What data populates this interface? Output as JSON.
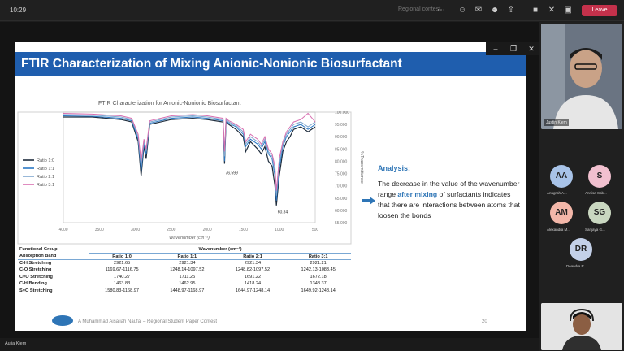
{
  "app": {
    "time": "10:29",
    "meeting_title": "Regional contest",
    "leave_label": "Leave"
  },
  "slide": {
    "title": "FTIR Characterization of Mixing Anionic-Nonionic Biosurfactant",
    "analysis_heading": "Analysis:",
    "analysis_before": "The decrease in the value of the wavenumber range ",
    "analysis_highlight": "after mixing",
    "analysis_after": " of surfactants indicates that there are interactions between atoms that loosen the bonds",
    "footer": "A Muhammad Aisaliah Naufal – Regional Student Paper Contest",
    "page_number": "20"
  },
  "chart_data": {
    "type": "line",
    "title": "FTIR Characterization for Anionic-Nonionic Biosurfactant",
    "xlabel": "Wavenumber (cm⁻¹)",
    "ylabel": "%Transmittance",
    "xlim": [
      4000,
      500
    ],
    "ylim": [
      55,
      100
    ],
    "x_ticks": [
      "4000",
      "3500",
      "3000",
      "2500",
      "2000",
      "1500",
      "1000",
      "500"
    ],
    "y_ticks": [
      "100.000",
      "95.000",
      "90.000",
      "85.000",
      "80.000",
      "75.000",
      "70.000",
      "65.000",
      "60.000",
      "55.000"
    ],
    "x_tick_values": [
      4000,
      3500,
      3000,
      2500,
      2000,
      1500,
      1000,
      500
    ],
    "y_tick_values": [
      100,
      95,
      90,
      85,
      80,
      75,
      70,
      65,
      60,
      55
    ],
    "annotations": [
      {
        "text": "76.599",
        "x": 1770,
        "y": 76.6
      },
      {
        "text": "60.84",
        "x": 1045,
        "y": 60.84
      }
    ],
    "legend_position": "left",
    "series": [
      {
        "name": "Ratio 1:0",
        "color": "#1f2d3d",
        "x": [
          4000,
          3600,
          3200,
          3050,
          2960,
          2920,
          2880,
          2850,
          2800,
          2500,
          2200,
          2000,
          1780,
          1760,
          1740,
          1700,
          1600,
          1500,
          1465,
          1400,
          1300,
          1250,
          1200,
          1150,
          1100,
          1060,
          1040,
          1000,
          950,
          900,
          850,
          800,
          700,
          600,
          500
        ],
        "y": [
          98,
          98,
          97,
          96,
          88,
          74,
          86,
          81,
          95,
          97,
          97.5,
          97,
          96,
          79,
          96,
          95,
          93,
          90,
          84,
          88,
          85,
          83,
          86,
          80,
          78,
          70,
          62,
          74,
          84,
          88,
          90,
          93,
          94,
          92,
          94
        ]
      },
      {
        "name": "Ratio 1:1",
        "color": "#2b78c4",
        "x": [
          4000,
          3600,
          3200,
          3050,
          2960,
          2920,
          2880,
          2850,
          2800,
          2500,
          2200,
          2000,
          1780,
          1760,
          1740,
          1700,
          1600,
          1500,
          1465,
          1400,
          1300,
          1250,
          1200,
          1150,
          1100,
          1060,
          1040,
          1000,
          950,
          900,
          850,
          800,
          700,
          600,
          500
        ],
        "y": [
          98.5,
          98.3,
          97.5,
          96.5,
          89,
          76,
          87,
          83,
          95.5,
          97.5,
          98,
          97.5,
          96.5,
          80,
          96.5,
          95.5,
          94,
          91,
          86,
          89,
          87,
          85,
          88,
          83,
          81,
          74,
          64,
          77,
          86,
          90,
          92,
          94,
          95,
          93,
          95
        ]
      },
      {
        "name": "Ratio 2:1",
        "color": "#7fa7cf",
        "x": [
          4000,
          3600,
          3200,
          3050,
          2960,
          2920,
          2880,
          2850,
          2800,
          2500,
          2200,
          2000,
          1780,
          1760,
          1740,
          1700,
          1600,
          1500,
          1465,
          1400,
          1300,
          1250,
          1200,
          1150,
          1100,
          1060,
          1040,
          1000,
          950,
          900,
          850,
          800,
          700,
          600,
          500
        ],
        "y": [
          99,
          98.8,
          98,
          97,
          90,
          78,
          88,
          84,
          96,
          98,
          98.5,
          98,
          97,
          82,
          97,
          96,
          94.5,
          92,
          87,
          90,
          88,
          86,
          89,
          84,
          82,
          76,
          66,
          79,
          87,
          91,
          93,
          95,
          96,
          94,
          96
        ]
      },
      {
        "name": "Ratio 3:1",
        "color": "#d86fb0",
        "x": [
          4000,
          3600,
          3200,
          3050,
          2960,
          2920,
          2880,
          2850,
          2800,
          2500,
          2200,
          2000,
          1780,
          1760,
          1740,
          1700,
          1600,
          1500,
          1465,
          1400,
          1300,
          1250,
          1200,
          1150,
          1100,
          1060,
          1040,
          1000,
          950,
          900,
          850,
          800,
          700,
          600,
          500
        ],
        "y": [
          99.5,
          99.2,
          98.5,
          97.5,
          91,
          80,
          89,
          85,
          96.5,
          98.5,
          99,
          98.5,
          97.5,
          84,
          97.5,
          96.5,
          95,
          93,
          88,
          91,
          89,
          87,
          90,
          85,
          83,
          78,
          68,
          81,
          88,
          92,
          94,
          96,
          97,
          99.5,
          96
        ]
      }
    ]
  },
  "table": {
    "header_left_1": "Functional Group",
    "header_left_2": "Absorption Band",
    "header_wave": "Wavenumber (cm⁻¹)",
    "columns": [
      "Ratio 1:0",
      "Ratio 1:1",
      "Ratio 2:1",
      "Ratio 3:1"
    ],
    "rows": [
      {
        "group": "C-H Stretching",
        "values": [
          "2921.65",
          "2921.34",
          "2921.34",
          "2921.21"
        ]
      },
      {
        "group": "C-O Stretching",
        "values": [
          "1169.67-1116.75",
          "1248.14-1097.52",
          "1248.82-1097.52",
          "1242.13-1083.45"
        ]
      },
      {
        "group": "C=O Stretching",
        "values": [
          "1740.27",
          "1711.25",
          "1691.22",
          "1672.18"
        ]
      },
      {
        "group": "C-H Bending",
        "values": [
          "1463.83",
          "1462.95",
          "1418.24",
          "1348.37"
        ]
      },
      {
        "group": "S=O Stretching",
        "values": [
          "1580.83-1168.97",
          "1448.97-1168.97",
          "1644.97-1248.14",
          "1649.92-1248.14"
        ]
      }
    ]
  },
  "participants": {
    "speaker_name": "Justin Kjem",
    "self_name": "Aulia Kjem",
    "avatars": [
      {
        "initials": "AA",
        "name": "Anugrah A...",
        "color": "#a8c3e8"
      },
      {
        "initials": "S",
        "name": "Annisa Sab...",
        "color": "#f1c0cf"
      },
      {
        "initials": "AM",
        "name": "Alexandra M...",
        "color": "#f3b7a9"
      },
      {
        "initials": "SG",
        "name": "Sanjaya G...",
        "color": "#c9d7c0"
      },
      {
        "initials": "DR",
        "name": "Deandra R...",
        "color": "#c3d0e8"
      }
    ]
  }
}
